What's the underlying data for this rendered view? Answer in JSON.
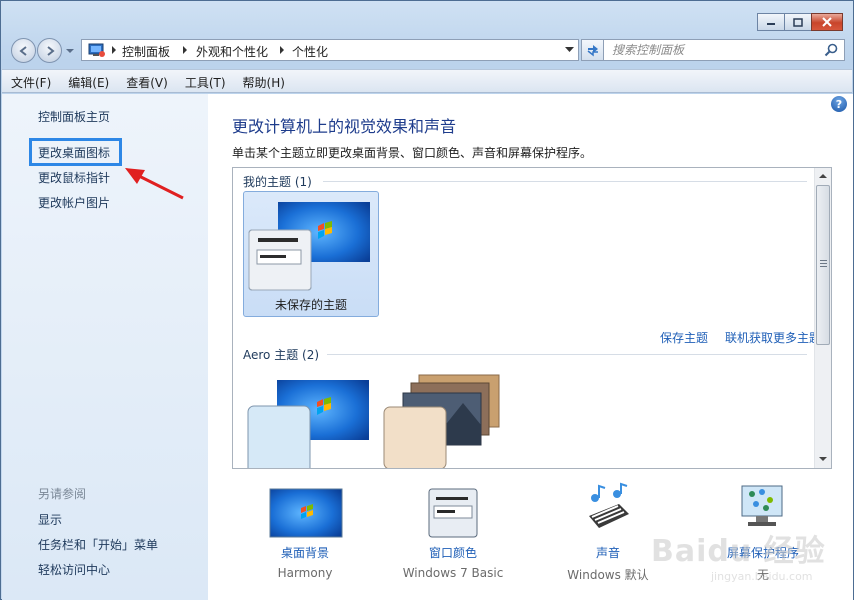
{
  "address": {
    "segments": [
      "控制面板",
      "外观和个性化",
      "个性化"
    ]
  },
  "search": {
    "placeholder": "搜索控制面板"
  },
  "menu": [
    "文件(F)",
    "编辑(E)",
    "查看(V)",
    "工具(T)",
    "帮助(H)"
  ],
  "sidebar": {
    "links": [
      "控制面板主页",
      "更改桌面图标",
      "更改鼠标指针",
      "更改帐户图片"
    ],
    "see_also_label": "另请参阅",
    "see_also": [
      "显示",
      "任务栏和「开始」菜单",
      "轻松访问中心"
    ]
  },
  "main": {
    "title": "更改计算机上的视觉效果和声音",
    "description": "单击某个主题立即更改桌面背景、窗口颜色、声音和屏幕保护程序。",
    "help": "?",
    "my_themes_label": "我的主题 (1)",
    "unsaved_theme": "未保存的主题",
    "save_theme": "保存主题",
    "get_more": "联机获取更多主题",
    "aero_label": "Aero 主题 (2)"
  },
  "bottom": [
    {
      "label": "桌面背景",
      "sub": "Harmony"
    },
    {
      "label": "窗口颜色",
      "sub": "Windows 7 Basic"
    },
    {
      "label": "声音",
      "sub": "Windows 默认"
    },
    {
      "label": "屏幕保护程序",
      "sub": "无"
    }
  ],
  "watermark": "Baidu 经验",
  "watermark_url": "jingyan.baidu.com",
  "colors": {
    "accent_link": "#1f5fb7",
    "title_blue": "#1e3c8c",
    "highlight": "#2d87e6",
    "annotation": "#e02020"
  }
}
